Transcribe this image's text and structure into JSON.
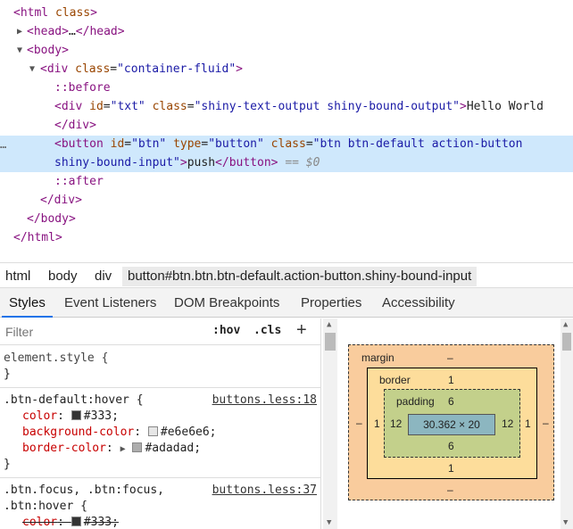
{
  "dom_tree": {
    "html_open": "html",
    "html_attr": "class",
    "head": "head",
    "head_close": "head",
    "ellipsis": "…",
    "body": "body",
    "div": "div",
    "div_class_attr": "class",
    "div_class_val": "\"container-fluid\"",
    "before": "::before",
    "div2": "div",
    "div2_id_attr": "id",
    "div2_id_val": "\"txt\"",
    "div2_class_attr": "class",
    "div2_class_val": "\"shiny-text-output shiny-bound-output\"",
    "div2_text": "Hello World",
    "div2_close": "div",
    "button": "button",
    "btn_id_attr": "id",
    "btn_id_val": "\"btn\"",
    "btn_type_attr": "type",
    "btn_type_val": "\"button\"",
    "btn_class_attr": "class",
    "btn_class_val_1": "\"btn btn-default action-button",
    "btn_class_val_2": "shiny-bound-input\"",
    "btn_text": "push",
    "btn_close": "button",
    "eq_dollar": "== $0",
    "dots": "…",
    "after": "::after",
    "div_close": "div",
    "body_close": "body",
    "html_close": "html"
  },
  "breadcrumb": [
    "html",
    "body",
    "div",
    "button#btn.btn.btn-default.action-button.shiny-bound-input"
  ],
  "tabs": [
    "Styles",
    "Event Listeners",
    "DOM Breakpoints",
    "Properties",
    "Accessibility"
  ],
  "filter": {
    "placeholder": "Filter",
    "hov": ":hov",
    "cls": ".cls",
    "plus": "+"
  },
  "rules": {
    "element_style": "element.style {",
    "element_close": "}",
    "r1_selector": ".btn-default:hover {",
    "r1_source": "buttons.less:18",
    "r1_p1_name": "color",
    "r1_p1_val": "#333;",
    "r1_p2_name": "background-color",
    "r1_p2_val": "#e6e6e6;",
    "r1_p3_name": "border-color",
    "r1_p3_val": "#adadad;",
    "r1_close": "}",
    "r2_selector_1": ".btn.focus, .btn:focus,",
    "r2_source": "buttons.less:37",
    "r2_selector_2": ".btn:hover {",
    "r2_p1_name": "color",
    "r2_p1_val": "#333;"
  },
  "colors": {
    "c333": "#333333",
    "ce6": "#e6e6e6",
    "cad": "#adadad"
  },
  "box_model": {
    "margin_label": "margin",
    "margin_top": "–",
    "margin_bottom": "–",
    "margin_left": "–",
    "margin_right": "–",
    "border_label": "border",
    "border_top": "1",
    "border_bottom": "1",
    "border_left": "1",
    "border_right": "1",
    "padding_label": "padding",
    "padding_top": "6",
    "padding_bottom": "6",
    "padding_left": "12",
    "padding_right": "12",
    "content": "30.362 × 20"
  }
}
